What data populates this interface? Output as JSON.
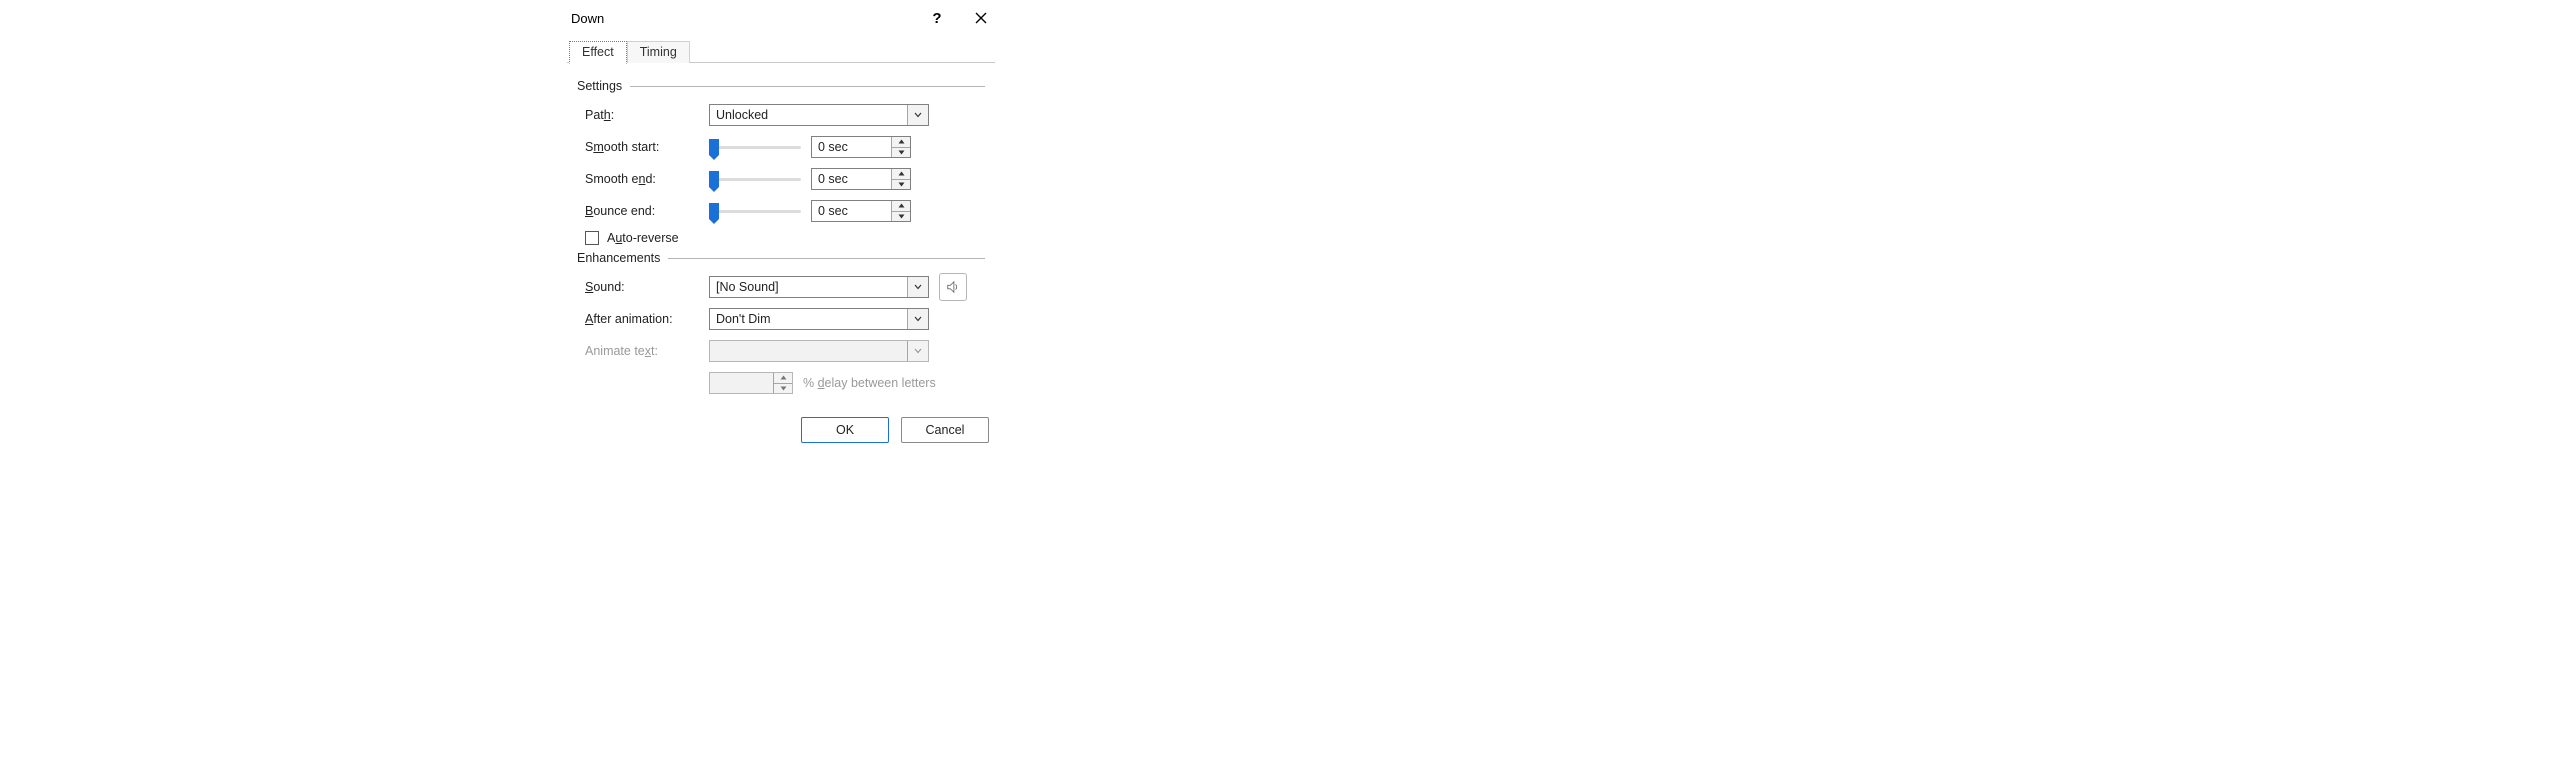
{
  "titlebar": {
    "title": "Down"
  },
  "tabs": {
    "effect": "Effect",
    "timing": "Timing"
  },
  "groups": {
    "settings": "Settings",
    "enhancements": "Enhancements"
  },
  "settings": {
    "path_label_pre": "Pat",
    "path_label_u": "h",
    "path_label_post": ":",
    "path_value": "Unlocked",
    "smooth_start_pre": "S",
    "smooth_start_u": "m",
    "smooth_start_post": "ooth start:",
    "smooth_start_value": "0 sec",
    "smooth_end_pre": "Smooth e",
    "smooth_end_u": "n",
    "smooth_end_post": "d:",
    "smooth_end_value": "0 sec",
    "bounce_end_u": "B",
    "bounce_end_post": "ounce end:",
    "bounce_end_value": "0 sec",
    "auto_reverse_pre": "A",
    "auto_reverse_u": "u",
    "auto_reverse_post": "to-reverse"
  },
  "enhancements": {
    "sound_u": "S",
    "sound_post": "ound:",
    "sound_value": "[No Sound]",
    "after_u": "A",
    "after_post": "fter animation:",
    "after_value": "Don't Dim",
    "animate_text_pre": "Animate te",
    "animate_text_u": "x",
    "animate_text_post": "t:",
    "delay_pre": "% ",
    "delay_u": "d",
    "delay_post": "elay between letters"
  },
  "footer": {
    "ok": "OK",
    "cancel": "Cancel"
  }
}
